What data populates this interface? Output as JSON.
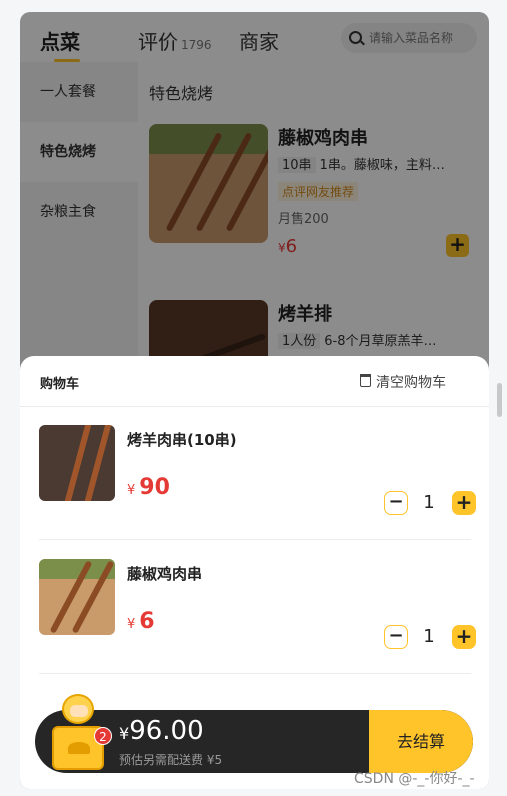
{
  "header": {
    "tabs": [
      {
        "label": "点菜"
      },
      {
        "label": "评价",
        "count": "1796"
      },
      {
        "label": "商家"
      }
    ],
    "search_placeholder": "请输入菜品名称"
  },
  "sidebar": {
    "items": [
      {
        "label": "一人套餐"
      },
      {
        "label": "特色烧烤"
      },
      {
        "label": "杂粮主食"
      }
    ]
  },
  "menu": {
    "section_title": "特色烧烤",
    "dishes": [
      {
        "name": "藤椒鸡肉串",
        "unit": "10串",
        "desc": "1串。藤椒味，主料…",
        "tag": "点评网友推荐",
        "sold": "月售200",
        "currency": "¥",
        "price": "6"
      },
      {
        "name": "烤羊排",
        "unit": "1人份",
        "desc": "6-8个月草原羔羊…"
      }
    ]
  },
  "cart": {
    "title": "购物车",
    "clear_label": "清空购物车",
    "items": [
      {
        "name": "烤羊肉串(10串)",
        "currency": "¥",
        "price": "90",
        "minus": "−",
        "qty": "1",
        "plus": "+"
      },
      {
        "name": "藤椒鸡肉串",
        "currency": "¥",
        "price": "6",
        "minus": "−",
        "qty": "1",
        "plus": "+"
      }
    ]
  },
  "checkout": {
    "currency": "¥",
    "total": "96.00",
    "note": "预估另需配送费 ¥5",
    "button_label": "去结算",
    "badge_count": "2",
    "add_symbol": "+"
  },
  "watermark": "CSDN @-_-你好-_-",
  "colors": {
    "accent": "#ffc429",
    "price": "#e53935",
    "bar": "#262626"
  }
}
